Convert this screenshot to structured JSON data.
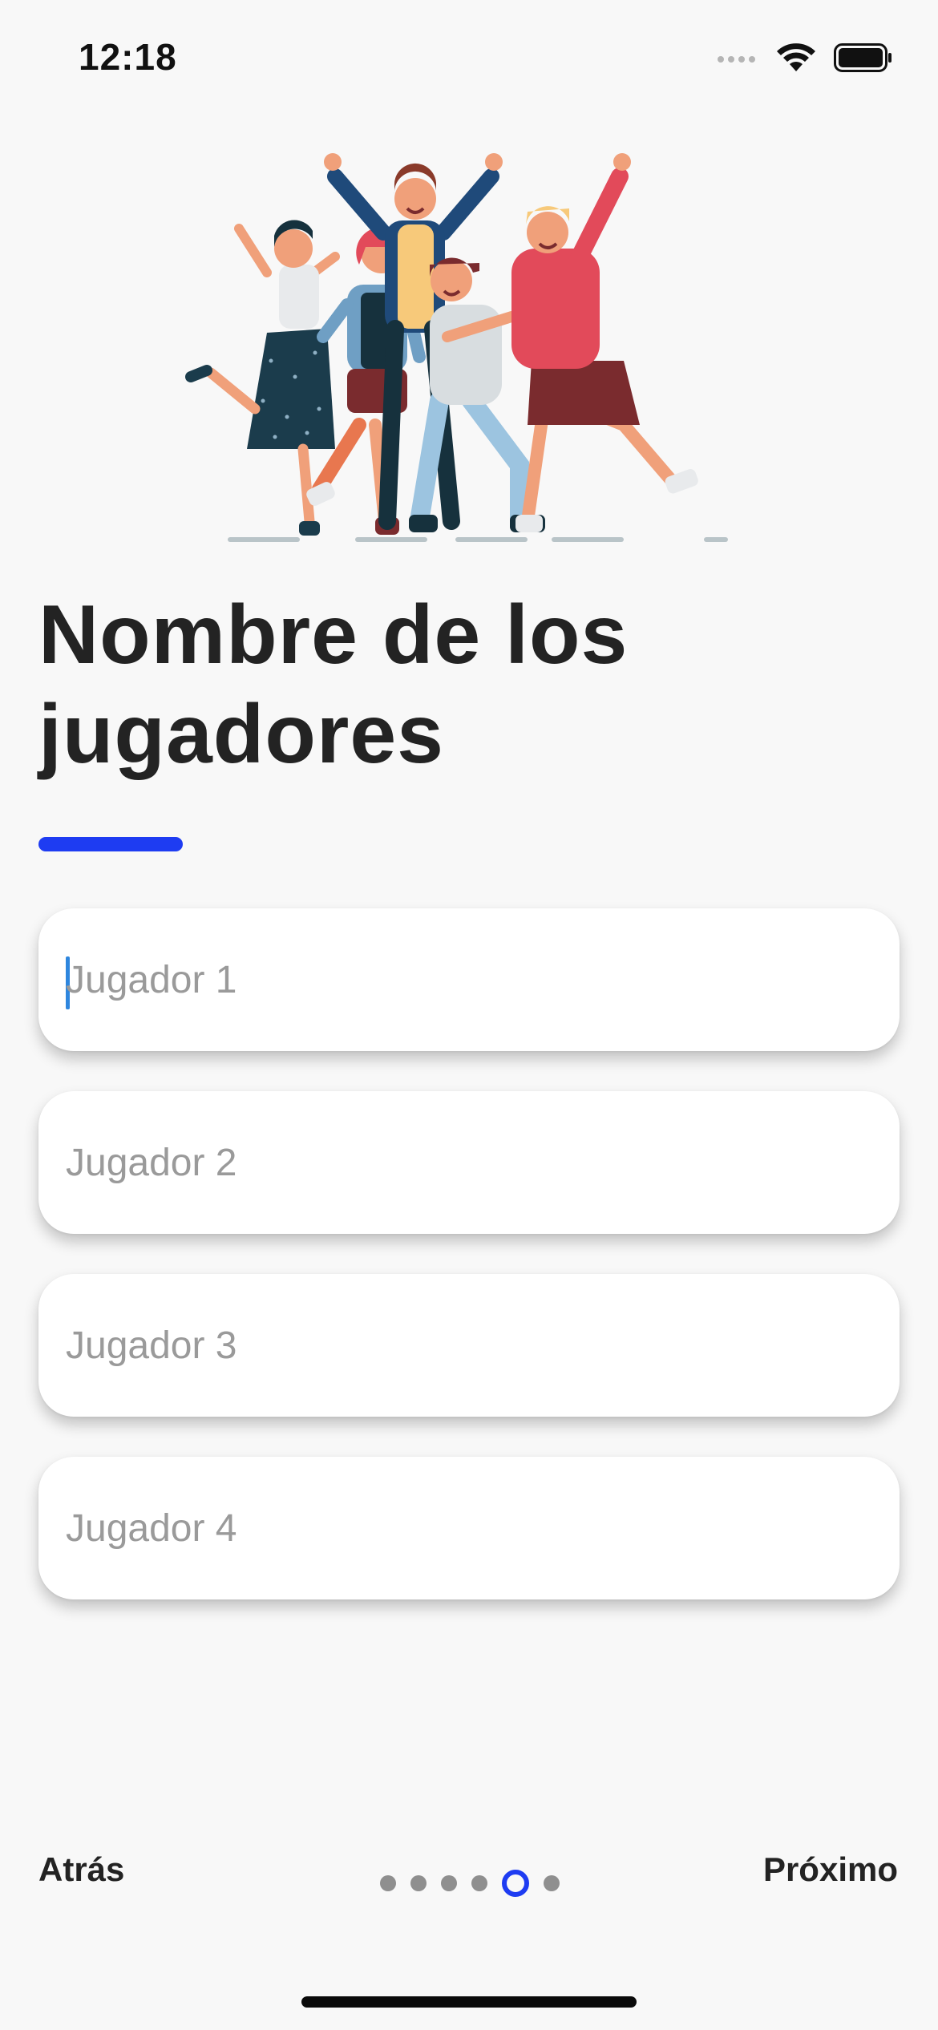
{
  "status_bar": {
    "time": "12:18",
    "icons": [
      "signal-icon",
      "wifi-icon",
      "battery-icon"
    ]
  },
  "illustration": {
    "name": "group-of-friends-illustration"
  },
  "title": "Nombre de los jugadores",
  "accent_color": "#1e3cf2",
  "players": [
    {
      "placeholder": "Jugador 1",
      "value": ""
    },
    {
      "placeholder": "Jugador 2",
      "value": ""
    },
    {
      "placeholder": "Jugador 3",
      "value": ""
    },
    {
      "placeholder": "Jugador 4",
      "value": ""
    }
  ],
  "navigation": {
    "back_label": "Atrás",
    "next_label": "Próximo",
    "page_count": 6,
    "current_page": 5
  }
}
